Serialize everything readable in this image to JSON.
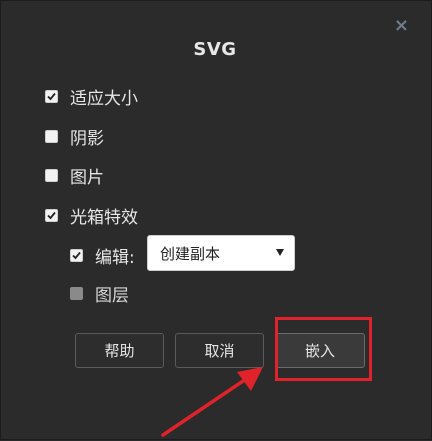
{
  "dialog": {
    "title": "SVG",
    "close_icon": "×"
  },
  "options": [
    {
      "label": "适应大小",
      "checked": true
    },
    {
      "label": "阴影",
      "checked": false
    },
    {
      "label": "图片",
      "checked": false
    },
    {
      "label": "光箱特效",
      "checked": true
    }
  ],
  "sub_options": {
    "edit_label": "编辑:",
    "edit_checked": true,
    "edit_select_value": "创建副本",
    "layer_label": "图层",
    "layer_checked": false
  },
  "buttons": {
    "help": "帮助",
    "cancel": "取消",
    "embed": "嵌入"
  },
  "colors": {
    "background": "#2b2b2b",
    "annotation_red": "#e0232a"
  }
}
